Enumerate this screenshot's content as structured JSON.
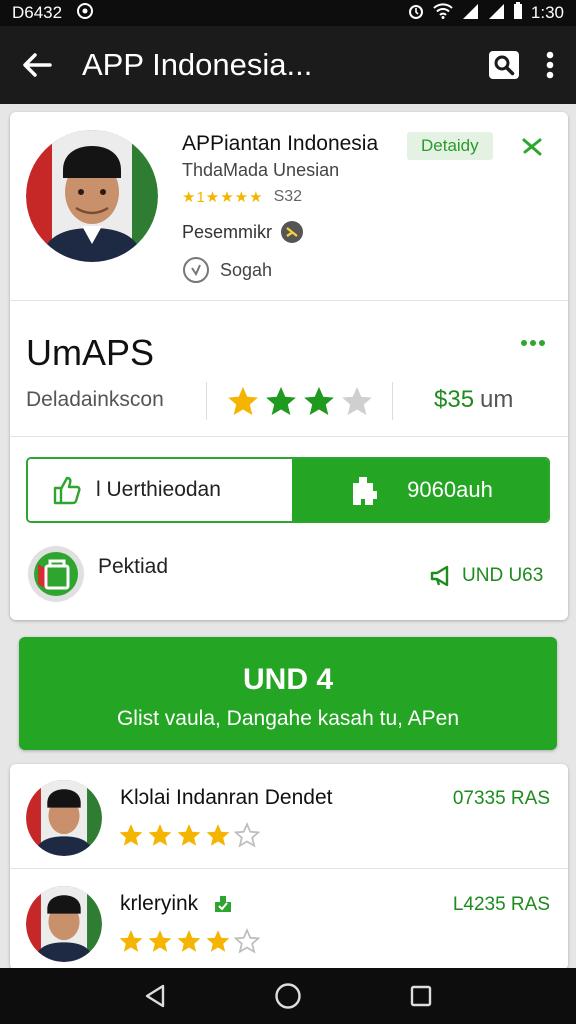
{
  "status_bar": {
    "left_text": "D6432",
    "time": "1:30"
  },
  "app_bar": {
    "title": "APP Indonesia..."
  },
  "profile": {
    "name": "APPiantan Indonesia",
    "badge": "Detaidy",
    "subtitle": "ThdaMada Unesian",
    "rating_text": "★1★★★★",
    "rating_count": "S32",
    "category": "Pesemmikr",
    "location": "Sogah"
  },
  "summary": {
    "heading": "UmAPS",
    "left_stat": "Deladainkscon",
    "stars_filled": 3,
    "stars_total": 4,
    "price": "$35",
    "price_unit": "um"
  },
  "actions": {
    "outline_label": "l Uerthieodan",
    "filled_label": "9060auh"
  },
  "pack": {
    "label": "Pektiad",
    "right_label": "UND U63"
  },
  "cta": {
    "line1": "UND 4",
    "line2": "Glist vaula, Dangahe kasah tu, APen"
  },
  "reviews": [
    {
      "name": "Klɔlai Indanran Dendet",
      "code": "07335 RAS",
      "stars": 4,
      "stars_total": 5,
      "verified": false
    },
    {
      "name": "krleryink",
      "code": "L4235 RAS",
      "stars": 4,
      "stars_total": 5,
      "verified": true
    }
  ],
  "colors": {
    "accent": "#24a524",
    "appbar": "#1b1b1b",
    "star": "#f4b400",
    "star_green": "#1f9a1f"
  }
}
